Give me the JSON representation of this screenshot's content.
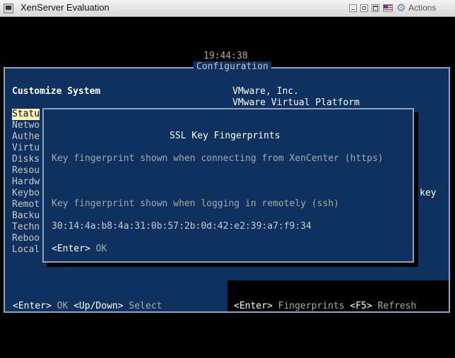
{
  "window": {
    "title": "XenServer Evaluation",
    "actions_label": "Actions",
    "icons": [
      "app-icon",
      "minimize-icon",
      "restore-icon",
      "maximize-icon",
      "flag-icon",
      "gear-icon"
    ]
  },
  "console": {
    "clock": "19:44:38",
    "panel_title": "Configuration",
    "left_heading": "Customize System",
    "menu_items": [
      "Statu",
      "Netwo",
      "Authe",
      "Virtu",
      "Disks",
      "Resou",
      "Hardw",
      "Keybo",
      "Remot",
      "Backu",
      "Techn",
      "Reboo",
      "Local"
    ],
    "selected_index": 0,
    "right": {
      "vendor": "VMware, Inc.",
      "product": "VMware Virtual Platform",
      "trailing_text": "key"
    },
    "help_left": {
      "enter_key": "<Enter>",
      "enter_action": "OK",
      "updown_key": "<Up/Down>",
      "updown_action": "Select"
    },
    "help_right": {
      "enter_key": "<Enter>",
      "enter_action": "Fingerprints",
      "f5_key": "<F5>",
      "f5_action": "Refresh"
    }
  },
  "dialog": {
    "title": "SSL Key Fingerprints",
    "line_https": "Key fingerprint shown when connecting from XenCenter (https)",
    "line_ssh": "Key fingerprint shown when logging in remotely (ssh)",
    "fingerprint": "30:14:4a:b8:4a:31:0b:57:2b:0d:42:e2:39:a7:f9:34",
    "ok_key": "<Enter>",
    "ok_action": "OK"
  },
  "colors": {
    "panel_bg": "#0e3160",
    "border": "#8fa3bf",
    "selection": "#fff8b0"
  }
}
